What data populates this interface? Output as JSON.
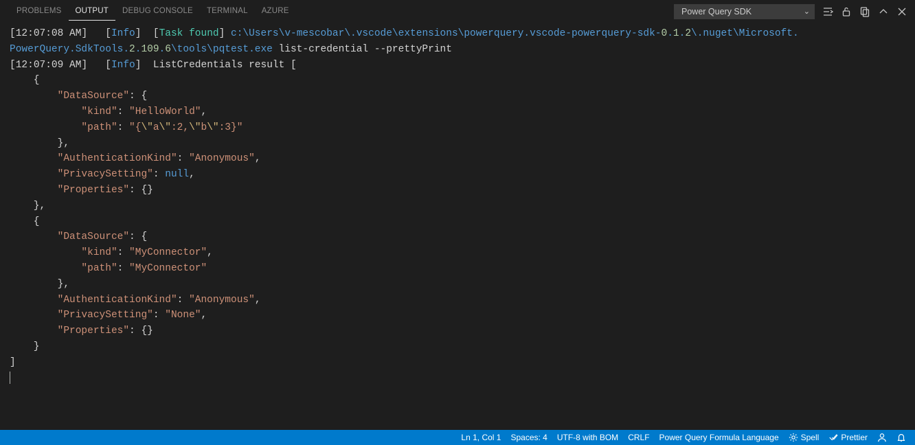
{
  "tabs": {
    "problems": "PROBLEMS",
    "output": "OUTPUT",
    "debug": "DEBUG CONSOLE",
    "terminal": "TERMINAL",
    "azure": "AZURE"
  },
  "channel": "Power Query SDK",
  "log": {
    "line1": {
      "ts_h": "12",
      "ts_m": "07",
      "ts_s": "08",
      "ts_ampm": "AM",
      "info": "Info",
      "task": "Task found",
      "path_a": "c:\\Users\\v-mescobar\\.vscode\\extensions\\powerquery.vscode-powerquery-sdk-",
      "path_v1": "0",
      "path_v2": "1",
      "path_v3": "2",
      "path_b": "\\.nuget\\Microsoft.",
      "path_c": "PowerQuery.SdkTools.",
      "path_w1": "2",
      "path_w2": "109",
      "path_w3": "6",
      "path_d": "\\tools\\pqtest.exe",
      "cmd": " list-credential --prettyPrint"
    },
    "line2": {
      "ts_h": "12",
      "ts_m": "07",
      "ts_s": "09",
      "ts_ampm": "AM",
      "info": "Info",
      "task": "ListCredentials result ["
    },
    "body": {
      "ds": "DataSource",
      "kind": "kind",
      "path": "path",
      "hw": "HelloWorld",
      "pjson_open": "\"{",
      "esc": "\\\"",
      "a": "a",
      "colon2": ":2,",
      "b": "b",
      "colon3": ":3}\"",
      "auth": "AuthenticationKind",
      "anon": "Anonymous",
      "priv": "PrivacySetting",
      "null": "null",
      "props": "Properties",
      "mc": "MyConnector",
      "none": "None"
    }
  },
  "status": {
    "ln": "Ln 1, Col 1",
    "spaces": "Spaces: 4",
    "enc": "UTF-8 with BOM",
    "eol": "CRLF",
    "lang": "Power Query Formula Language",
    "spell": "Spell",
    "prettier": "Prettier"
  }
}
